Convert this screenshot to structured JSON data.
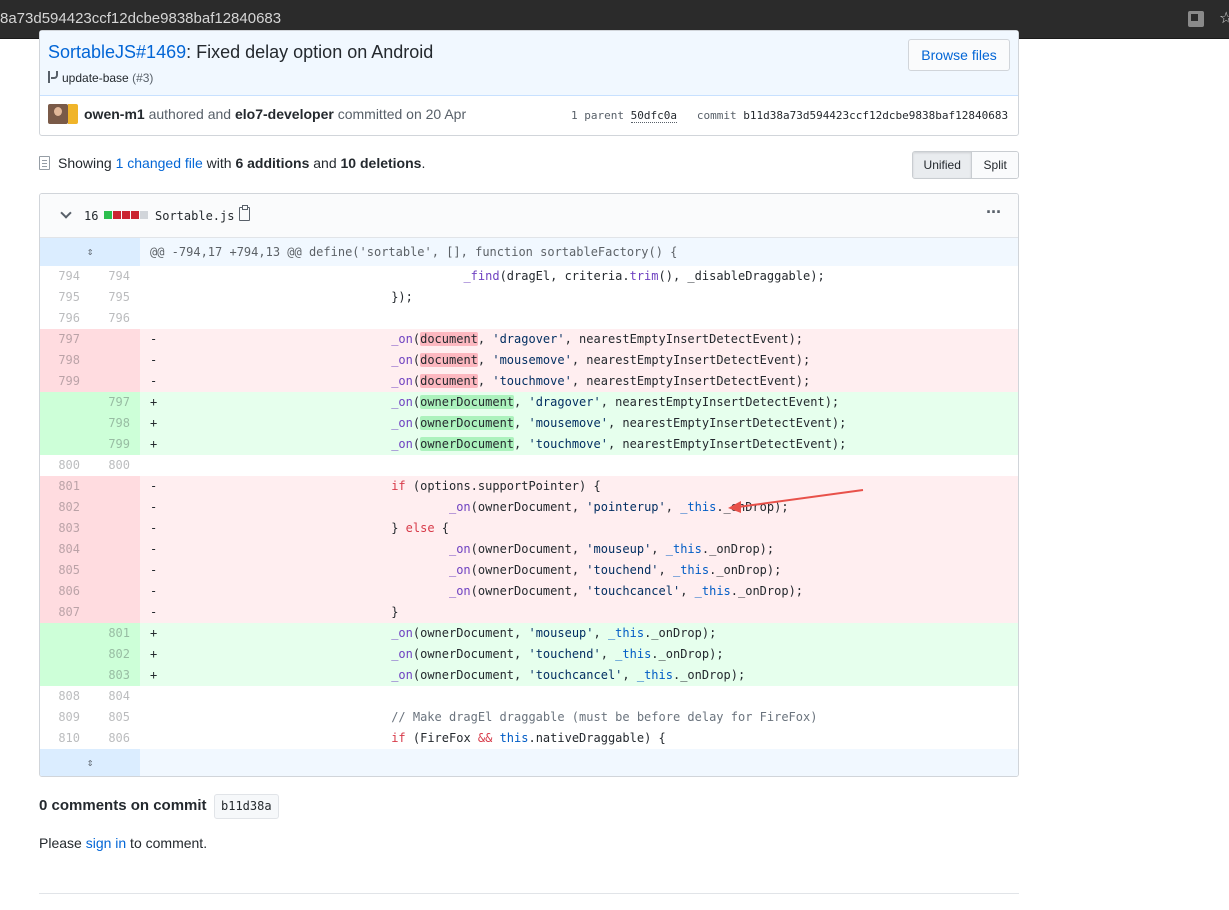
{
  "browser": {
    "url": "8a73d594423ccf12dcbe9838baf12840683"
  },
  "commit": {
    "title_link": "SortableJS#1469",
    "title_rest": ": Fixed delay option on Android",
    "browse_files": "Browse files",
    "branch": "update-base",
    "pr": "(#3)",
    "author": "owen-m1",
    "authored_text": " authored and ",
    "committer": "elo7-developer",
    "committed_text": " committed on 20 Apr",
    "parent_label": "1 parent",
    "parent_sha": "50dfc0a",
    "commit_label": "commit",
    "commit_sha": "b11d38a73d594423ccf12dcbe9838baf12840683"
  },
  "summary": {
    "showing": "Showing ",
    "changed": "1 changed file",
    "with": " with ",
    "additions": "6 additions",
    "and": " and ",
    "deletions": "10 deletions",
    "period": ".",
    "unified": "Unified",
    "split": "Split"
  },
  "file": {
    "diffstat": "16",
    "name": "Sortable.js",
    "diffstat_blocks": [
      "#2cbe4e",
      "#cb2431",
      "#cb2431",
      "#cb2431",
      "#d1d5da"
    ],
    "hunk_header": "@@ -794,17 +794,13 @@ define('sortable', [], function sortableFactory() {"
  },
  "diff_lines": [
    {
      "type": "ctx",
      "old": "794",
      "new": "794",
      "indent": "                                        ",
      "parts": [
        [
          "",
          "  "
        ],
        [
          "fn",
          "_find"
        ],
        [
          "",
          "(dragEl, criteria."
        ],
        [
          "fn",
          "trim"
        ],
        [
          "",
          "(), _disableDraggable);"
        ]
      ]
    },
    {
      "type": "ctx",
      "old": "795",
      "new": "795",
      "indent": "                                ",
      "parts": [
        [
          "",
          "});"
        ]
      ]
    },
    {
      "type": "ctx",
      "old": "796",
      "new": "796",
      "indent": "",
      "parts": []
    },
    {
      "type": "del",
      "old": "797",
      "new": "",
      "indent": "                                ",
      "parts": [
        [
          "fn",
          "_on"
        ],
        [
          "",
          "("
        ],
        [
          "hl-del",
          "document"
        ],
        [
          "",
          ", "
        ],
        [
          "str",
          "'dragover'"
        ],
        [
          "",
          ", nearestEmptyInsertDetectEvent);"
        ]
      ]
    },
    {
      "type": "del",
      "old": "798",
      "new": "",
      "indent": "                                ",
      "parts": [
        [
          "fn",
          "_on"
        ],
        [
          "",
          "("
        ],
        [
          "hl-del",
          "document"
        ],
        [
          "",
          ", "
        ],
        [
          "str",
          "'mousemove'"
        ],
        [
          "",
          ", nearestEmptyInsertDetectEvent);"
        ]
      ]
    },
    {
      "type": "del",
      "old": "799",
      "new": "",
      "indent": "                                ",
      "parts": [
        [
          "fn",
          "_on"
        ],
        [
          "",
          "("
        ],
        [
          "hl-del",
          "document"
        ],
        [
          "",
          ", "
        ],
        [
          "str",
          "'touchmove'"
        ],
        [
          "",
          ", nearestEmptyInsertDetectEvent);"
        ]
      ]
    },
    {
      "type": "add",
      "old": "",
      "new": "797",
      "indent": "                                ",
      "parts": [
        [
          "fn",
          "_on"
        ],
        [
          "",
          "("
        ],
        [
          "hl-add",
          "ownerDocument"
        ],
        [
          "",
          ", "
        ],
        [
          "str",
          "'dragover'"
        ],
        [
          "",
          ", nearestEmptyInsertDetectEvent);"
        ]
      ]
    },
    {
      "type": "add",
      "old": "",
      "new": "798",
      "indent": "                                ",
      "parts": [
        [
          "fn",
          "_on"
        ],
        [
          "",
          "("
        ],
        [
          "hl-add",
          "ownerDocument"
        ],
        [
          "",
          ", "
        ],
        [
          "str",
          "'mousemove'"
        ],
        [
          "",
          ", nearestEmptyInsertDetectEvent);"
        ]
      ]
    },
    {
      "type": "add",
      "old": "",
      "new": "799",
      "indent": "                                ",
      "parts": [
        [
          "fn",
          "_on"
        ],
        [
          "",
          "("
        ],
        [
          "hl-add",
          "ownerDocument"
        ],
        [
          "",
          ", "
        ],
        [
          "str",
          "'touchmove'"
        ],
        [
          "",
          ", nearestEmptyInsertDetectEvent);"
        ]
      ]
    },
    {
      "type": "ctx",
      "old": "800",
      "new": "800",
      "indent": "",
      "parts": []
    },
    {
      "type": "del",
      "old": "801",
      "new": "",
      "indent": "                                ",
      "parts": [
        [
          "kw",
          "if"
        ],
        [
          "",
          " (options.supportPointer) {"
        ]
      ]
    },
    {
      "type": "del",
      "old": "802",
      "new": "",
      "indent": "                                        ",
      "parts": [
        [
          "fn",
          "_on"
        ],
        [
          "",
          "(ownerDocument, "
        ],
        [
          "str",
          "'pointerup'"
        ],
        [
          "",
          ", "
        ],
        [
          "var",
          "_this"
        ],
        [
          "",
          "._onDrop);"
        ]
      ]
    },
    {
      "type": "del",
      "old": "803",
      "new": "",
      "indent": "                                ",
      "parts": [
        [
          "",
          "} "
        ],
        [
          "kw",
          "else"
        ],
        [
          "",
          " {"
        ]
      ]
    },
    {
      "type": "del",
      "old": "804",
      "new": "",
      "indent": "                                        ",
      "parts": [
        [
          "fn",
          "_on"
        ],
        [
          "",
          "(ownerDocument, "
        ],
        [
          "str",
          "'mouseup'"
        ],
        [
          "",
          ", "
        ],
        [
          "var",
          "_this"
        ],
        [
          "",
          "._onDrop);"
        ]
      ]
    },
    {
      "type": "del",
      "old": "805",
      "new": "",
      "indent": "                                        ",
      "parts": [
        [
          "fn",
          "_on"
        ],
        [
          "",
          "(ownerDocument, "
        ],
        [
          "str",
          "'touchend'"
        ],
        [
          "",
          ", "
        ],
        [
          "var",
          "_this"
        ],
        [
          "",
          "._onDrop);"
        ]
      ]
    },
    {
      "type": "del",
      "old": "806",
      "new": "",
      "indent": "                                        ",
      "parts": [
        [
          "fn",
          "_on"
        ],
        [
          "",
          "(ownerDocument, "
        ],
        [
          "str",
          "'touchcancel'"
        ],
        [
          "",
          ", "
        ],
        [
          "var",
          "_this"
        ],
        [
          "",
          "._onDrop);"
        ]
      ]
    },
    {
      "type": "del",
      "old": "807",
      "new": "",
      "indent": "                                ",
      "parts": [
        [
          "",
          "}"
        ]
      ]
    },
    {
      "type": "add",
      "old": "",
      "new": "801",
      "indent": "                                ",
      "parts": [
        [
          "fn",
          "_on"
        ],
        [
          "",
          "(ownerDocument, "
        ],
        [
          "str",
          "'mouseup'"
        ],
        [
          "",
          ", "
        ],
        [
          "var",
          "_this"
        ],
        [
          "",
          "._onDrop);"
        ]
      ]
    },
    {
      "type": "add",
      "old": "",
      "new": "802",
      "indent": "                                ",
      "parts": [
        [
          "fn",
          "_on"
        ],
        [
          "",
          "(ownerDocument, "
        ],
        [
          "str",
          "'touchend'"
        ],
        [
          "",
          ", "
        ],
        [
          "var",
          "_this"
        ],
        [
          "",
          "._onDrop);"
        ]
      ]
    },
    {
      "type": "add",
      "old": "",
      "new": "803",
      "indent": "                                ",
      "parts": [
        [
          "fn",
          "_on"
        ],
        [
          "",
          "(ownerDocument, "
        ],
        [
          "str",
          "'touchcancel'"
        ],
        [
          "",
          ", "
        ],
        [
          "var",
          "_this"
        ],
        [
          "",
          "._onDrop);"
        ]
      ]
    },
    {
      "type": "ctx",
      "old": "808",
      "new": "804",
      "indent": "",
      "parts": []
    },
    {
      "type": "ctx",
      "old": "809",
      "new": "805",
      "indent": "                                ",
      "parts": [
        [
          "cmt",
          "// Make dragEl draggable (must be before delay for FireFox)"
        ]
      ]
    },
    {
      "type": "ctx",
      "old": "810",
      "new": "806",
      "indent": "                                ",
      "parts": [
        [
          "kw",
          "if"
        ],
        [
          "",
          " (FireFox "
        ],
        [
          "kw",
          "&&"
        ],
        [
          "",
          " "
        ],
        [
          "var",
          "this"
        ],
        [
          "",
          ".nativeDraggable) {"
        ]
      ]
    }
  ],
  "comments": {
    "heading": "0 comments on commit",
    "sha": "b11d38a",
    "please": "Please ",
    "signin": "sign in",
    "to_comment": " to comment."
  },
  "colors": {
    "link": "#0366d6",
    "annotation_arrow": "#e8514a"
  }
}
